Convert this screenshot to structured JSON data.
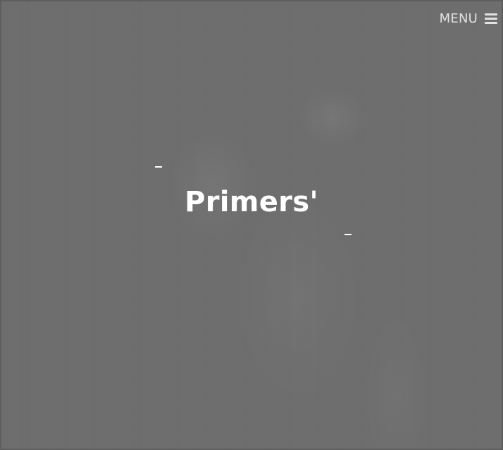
{
  "header": {
    "menu_label": "MENU",
    "menu_icon": "hamburger-icon"
  },
  "hero": {
    "title": "Primers'"
  },
  "colors": {
    "overlay": "#6d6d6d",
    "title": "#ffffff",
    "menu": "#e2e2e2"
  }
}
